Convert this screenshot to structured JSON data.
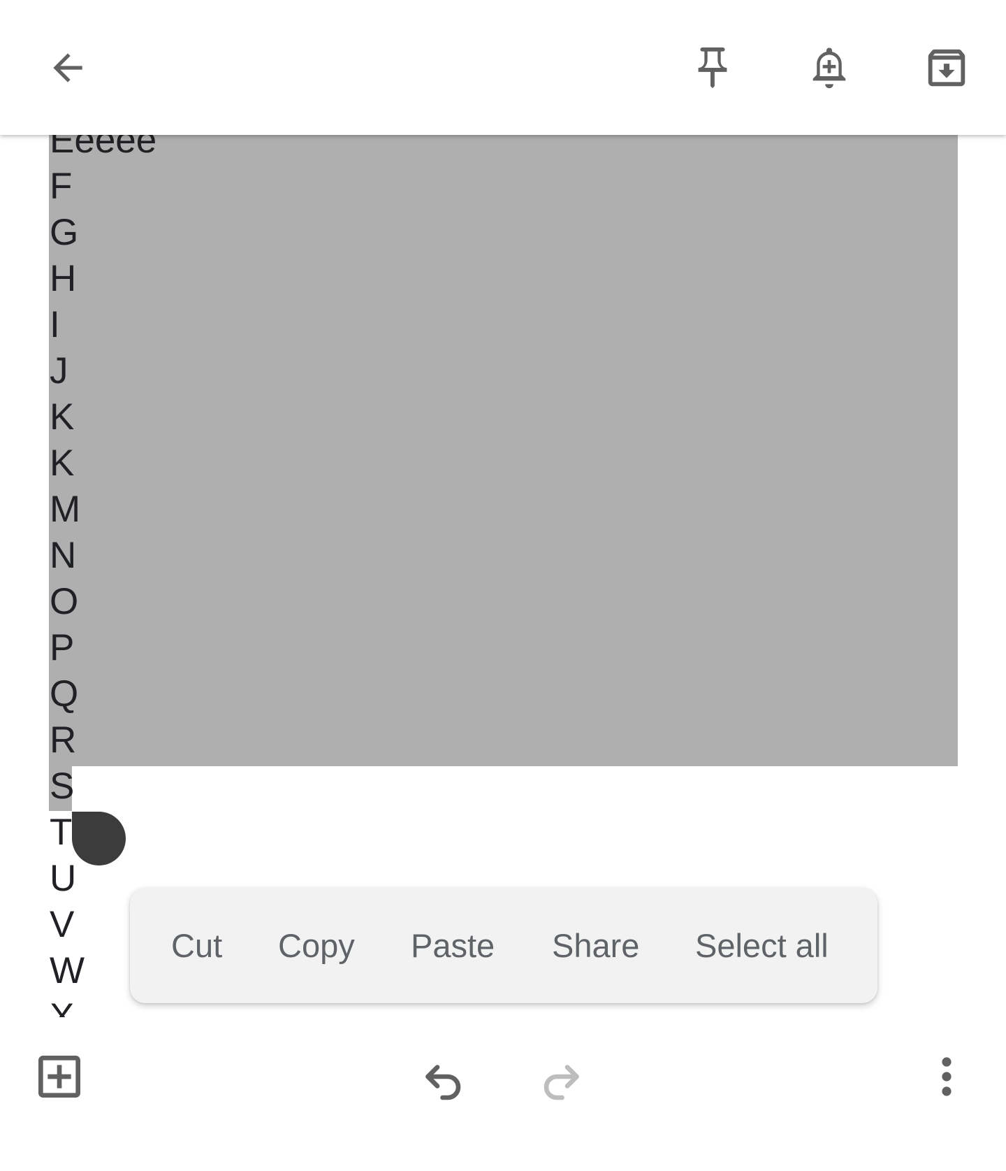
{
  "topbar": {
    "back_icon": "arrow-back-icon",
    "pin_icon": "pin-icon",
    "reminder_icon": "add-reminder-bell-icon",
    "archive_icon": "archive-icon"
  },
  "note": {
    "lines": [
      "Eeeee",
      "F",
      "G",
      "H",
      "I",
      "J",
      "K",
      "K",
      "M",
      "N",
      "O",
      "P",
      "Q",
      "R",
      "S",
      "T",
      "U",
      "V",
      "W",
      "X"
    ],
    "selection_color": "#afafaf"
  },
  "context_menu": {
    "items": [
      "Cut",
      "Copy",
      "Paste",
      "Share",
      "Select all"
    ]
  },
  "bottombar": {
    "add_icon": "add-box-icon",
    "undo_icon": "undo-icon",
    "redo_icon": "redo-icon",
    "more_icon": "more-vert-icon"
  },
  "colors": {
    "icon": "#616161",
    "icon_disabled": "#bdbdbd",
    "text": "#202124",
    "menu_text": "#5f6368",
    "menu_background": "#f2f2f2",
    "handle": "#3c3c3c"
  }
}
